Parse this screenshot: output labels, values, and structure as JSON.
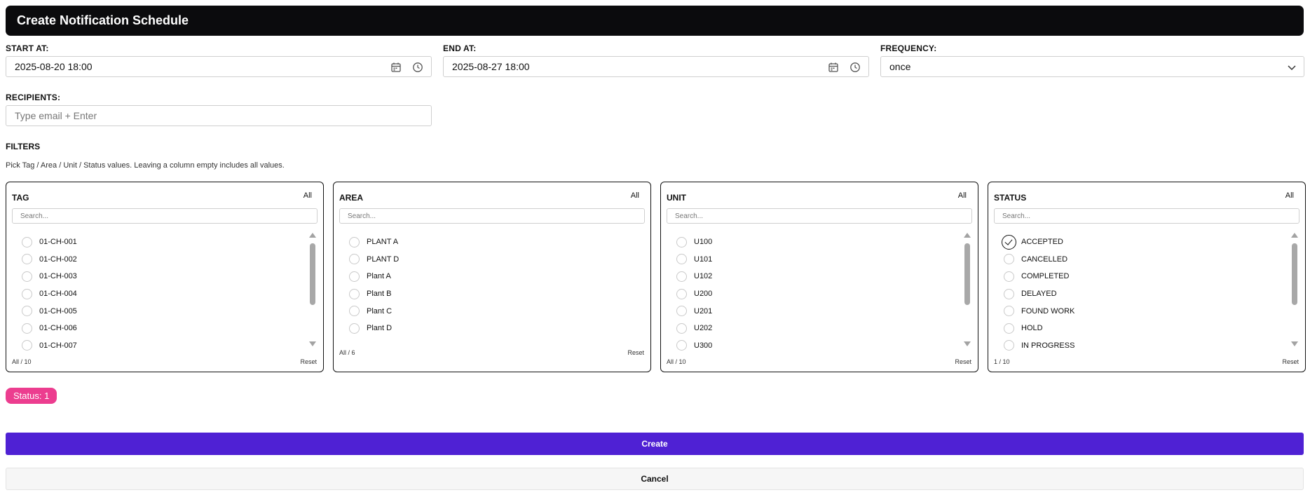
{
  "header": {
    "title": "Create Notification Schedule"
  },
  "start_at": {
    "label": "START AT:",
    "value": "2025-08-20 18:00"
  },
  "end_at": {
    "label": "END AT:",
    "value": "2025-08-27 18:00"
  },
  "frequency": {
    "label": "FREQUENCY:",
    "value": "once"
  },
  "recipients": {
    "label": "RECIPIENTS:",
    "placeholder": "Type email + Enter"
  },
  "filters": {
    "title": "FILTERS",
    "help": "Pick Tag / Area / Unit / Status values. Leaving a column empty includes all values.",
    "all_label": "All",
    "reset_label": "Reset",
    "search_placeholder": "Search...",
    "tag": {
      "title": "TAG",
      "count": "All / 10",
      "options": [
        "01-CH-001",
        "01-CH-002",
        "01-CH-003",
        "01-CH-004",
        "01-CH-005",
        "01-CH-006",
        "01-CH-007"
      ]
    },
    "area": {
      "title": "AREA",
      "count": "All / 6",
      "options": [
        "PLANT A",
        "PLANT D",
        "Plant A",
        "Plant B",
        "Plant C",
        "Plant D"
      ]
    },
    "unit": {
      "title": "UNIT",
      "count": "All / 10",
      "options": [
        "U100",
        "U101",
        "U102",
        "U200",
        "U201",
        "U202",
        "U300"
      ]
    },
    "status": {
      "title": "STATUS",
      "count": "1 / 10",
      "options": [
        "ACCEPTED",
        "CANCELLED",
        "COMPLETED",
        "DELAYED",
        "FOUND WORK",
        "HOLD",
        "IN PROGRESS"
      ],
      "selected": [
        "ACCEPTED"
      ]
    }
  },
  "badge": {
    "label": "Status: 1",
    "color": "#ec3d8f"
  },
  "actions": {
    "create_label": "Create",
    "cancel_label": "Cancel",
    "create_color": "#4f21d4"
  }
}
